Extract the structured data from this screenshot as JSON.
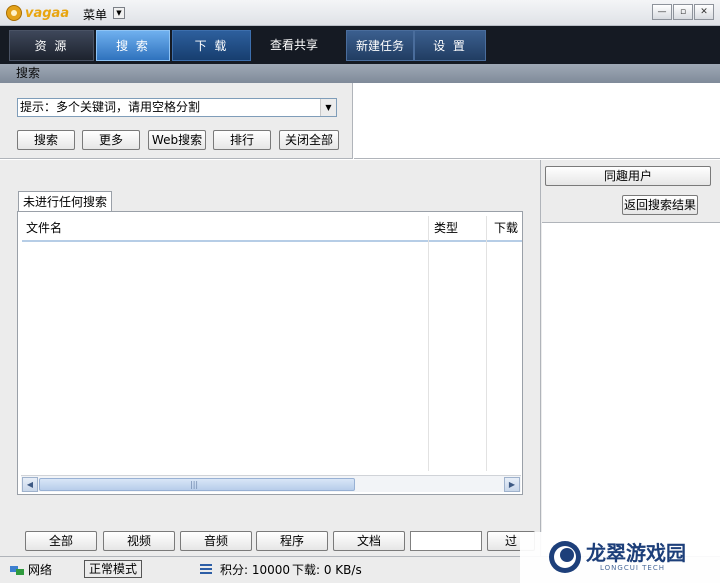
{
  "app": {
    "logo_text": "vagaa",
    "menu_label": "菜单"
  },
  "window_controls": {
    "minimize": "—",
    "restore": "▫",
    "close": "✕"
  },
  "nav": {
    "tabs": [
      {
        "label": "资 源"
      },
      {
        "label": "搜 索"
      },
      {
        "label": "下 载"
      },
      {
        "label": "查看共享"
      },
      {
        "label": "新建任务"
      },
      {
        "label": "设 置"
      }
    ]
  },
  "section": {
    "title": "搜索"
  },
  "search": {
    "placeholder": "提示：多个关键词，请用空格分割",
    "buttons": [
      "搜索",
      "更多",
      "Web搜索",
      "排行",
      "关闭全部"
    ]
  },
  "results": {
    "tab_label": "未进行任何搜索",
    "columns": [
      "文件名",
      "类型",
      "下载"
    ]
  },
  "right_panel": {
    "similar_users_button": "同趣用户",
    "back_button": "返回搜索结果"
  },
  "filters": {
    "buttons": [
      "全部",
      "视频",
      "音频",
      "程序",
      "文档",
      "过"
    ]
  },
  "status": {
    "network": "网络",
    "mode": "正常模式",
    "points": "积分: 10000",
    "download": "下载: 0 KB/s"
  },
  "watermark": {
    "name": "龙翠游戏园",
    "sub": "LONGCUI TECH"
  }
}
